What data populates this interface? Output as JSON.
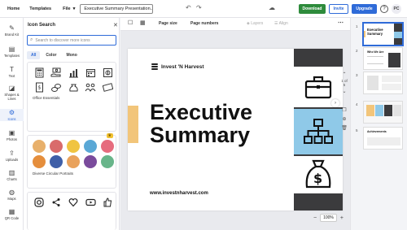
{
  "topbar": {
    "home": "Home",
    "templates": "Templates",
    "file": "File",
    "doc_title": "Executive Summary Presentation...",
    "download": "Download",
    "invite": "Invite",
    "upgrade": "Upgrade",
    "help": "?",
    "avatar": "PC"
  },
  "rail": {
    "brand_kit": "Brand Kit",
    "templates": "Templates",
    "text": "Text",
    "shapes": "Shapes & Lines",
    "icons": "Icons",
    "photos": "Photos",
    "uploads": "Uploads",
    "charts": "Charts",
    "maps": "Maps",
    "qr": "QR Code"
  },
  "panel": {
    "title": "Icon Search",
    "search_placeholder": "Search to discover more icons",
    "filters": [
      "All",
      "Color",
      "Mono"
    ],
    "sections": {
      "office": "Office Essentials",
      "portraits": "Diverse Circular Portraits"
    }
  },
  "toolbar": {
    "page_size": "Page size",
    "page_numbers": "Page numbers",
    "layers": "Layers",
    "align": "Align"
  },
  "slide": {
    "logo_text": "Invest 'N Harvest",
    "title_line1": "Executive",
    "title_line2": "Summary",
    "url": "www.investnharvest.com",
    "accent_color": "#f2c57a",
    "blue_color": "#8fc9e8"
  },
  "side_controls": {
    "page_counter": "1 of 5"
  },
  "zoom": {
    "minus": "−",
    "value": "100%",
    "plus": "+"
  },
  "thumbs": [
    {
      "num": "1",
      "title": "Executive Summary"
    },
    {
      "num": "2",
      "title": "Who We Are"
    },
    {
      "num": "3",
      "title": ""
    },
    {
      "num": "4",
      "title": ""
    },
    {
      "num": "5",
      "title": "Achievements"
    }
  ]
}
